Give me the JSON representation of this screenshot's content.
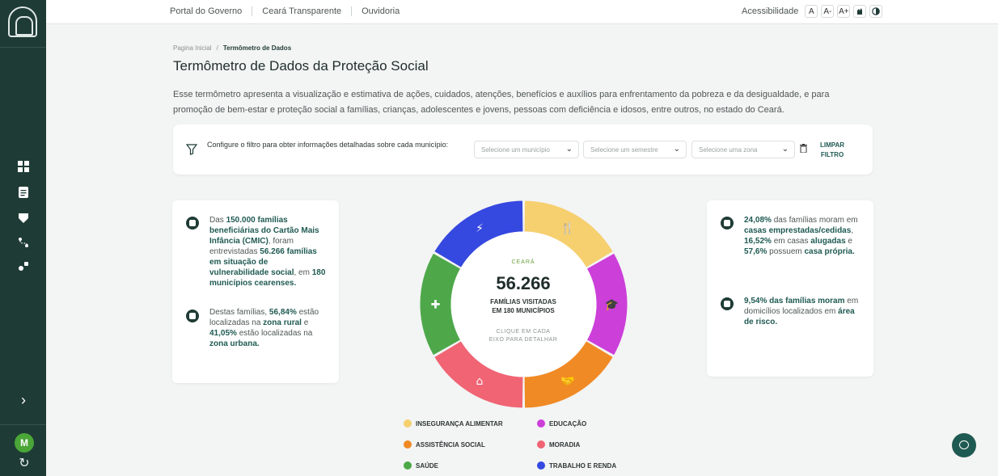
{
  "topbar": {
    "links": [
      "Portal do Governo",
      "Ceará Transparente",
      "Ouvidoria"
    ],
    "accessibility_label": "Acessibilidade",
    "font_buttons": [
      "A",
      "A-",
      "A+"
    ]
  },
  "sidebar": {
    "icons": [
      "logo-icon",
      "dashboard-icon",
      "document-icon",
      "tag-icon",
      "route-icon",
      "groups-icon"
    ],
    "avatar_letter": "M"
  },
  "breadcrumb": {
    "home": "Pagina Inicial",
    "separator": "/",
    "current": "Termômetro de Dados"
  },
  "page": {
    "title": "Termômetro de Dados da Proteção Social",
    "description": "Esse termômetro apresenta a visualização e estimativa de ações, cuidados, atenções, benefícios e auxílios para enfrentamento da pobreza e da desigualdade, e para promoção de bem-estar e proteção social a famílias, crianças, adolescentes e jovens, pessoas com deficiência e idosos, entre outros, no estado do Ceará."
  },
  "filter": {
    "label": "Configure o filtro para obter informações detalhadas sobre cada município:",
    "municipio_placeholder": "Selecione um município",
    "semestre_placeholder": "Selecione um semestre",
    "zona_placeholder": "Selecione uma zona",
    "clear_line1": "LIMPAR",
    "clear_line2": "FILTRO"
  },
  "left_card": {
    "p1_a": "Das ",
    "p1_b": "150.000 famílias beneficiárias do Cartão Mais Infância (CMIC)",
    "p1_c": ", foram entrevistadas ",
    "p1_d": "56.266 famílias em situação de vulnerabilidade social",
    "p1_e": ", em ",
    "p1_f": "180 municípios cearenses.",
    "p2_a": "Destas famílias, ",
    "p2_b": "56,84%",
    "p2_c": " estão localizadas na ",
    "p2_d": "zona rural",
    "p2_e": " e ",
    "p2_f": "41,05%",
    "p2_g": " estão localizadas na ",
    "p2_h": "zona urbana."
  },
  "right_card": {
    "p1_a": "24,08%",
    "p1_b": " das famílias moram em ",
    "p1_c": "casas emprestadas/cedidas",
    "p1_d": ", ",
    "p1_e": "16,52%",
    "p1_f": " em casas ",
    "p1_g": "alugadas",
    "p1_h": " e ",
    "p1_i": "57,6%",
    "p1_j": " possuem ",
    "p1_k": "casa própria.",
    "p2_a": "9,54% das famílias moram",
    "p2_b": " em domicílios localizados em ",
    "p2_c": "área de risco."
  },
  "donut": {
    "region": "CEARÁ",
    "total": "56.266",
    "sub_line1": "FAMÍLIAS VISITADAS",
    "sub_line2": "EM 180 MUNICÍPIOS",
    "hint_line1": "CLIQUE EM CADA",
    "hint_line2": "EIXO PARA DETALHAR",
    "segments": [
      {
        "name": "insegurança alimentar",
        "color": "#f6cf6f",
        "icon": "cutlery-icon"
      },
      {
        "name": "educação",
        "color": "#cc3fd9",
        "icon": "graduation-icon"
      },
      {
        "name": "assistência social",
        "color": "#f08a24",
        "icon": "handshake-icon"
      },
      {
        "name": "moradia",
        "color": "#f06474",
        "icon": "house-icon"
      },
      {
        "name": "saúde",
        "color": "#4ea84a",
        "icon": "cross-icon"
      },
      {
        "name": "trabalho e renda",
        "color": "#3548e0",
        "icon": "plug-icon"
      }
    ]
  },
  "legend": [
    {
      "label": "INSEGURANÇA ALIMENTAR",
      "color": "#f6cf6f"
    },
    {
      "label": "EDUCAÇÃO",
      "color": "#cc3fd9"
    },
    {
      "label": "ASSISTÊNCIA SOCIAL",
      "color": "#f08a24"
    },
    {
      "label": "MORADIA",
      "color": "#f06474"
    },
    {
      "label": "SAÚDE",
      "color": "#4ea84a"
    },
    {
      "label": "TRABALHO E RENDA",
      "color": "#3548e0"
    }
  ]
}
